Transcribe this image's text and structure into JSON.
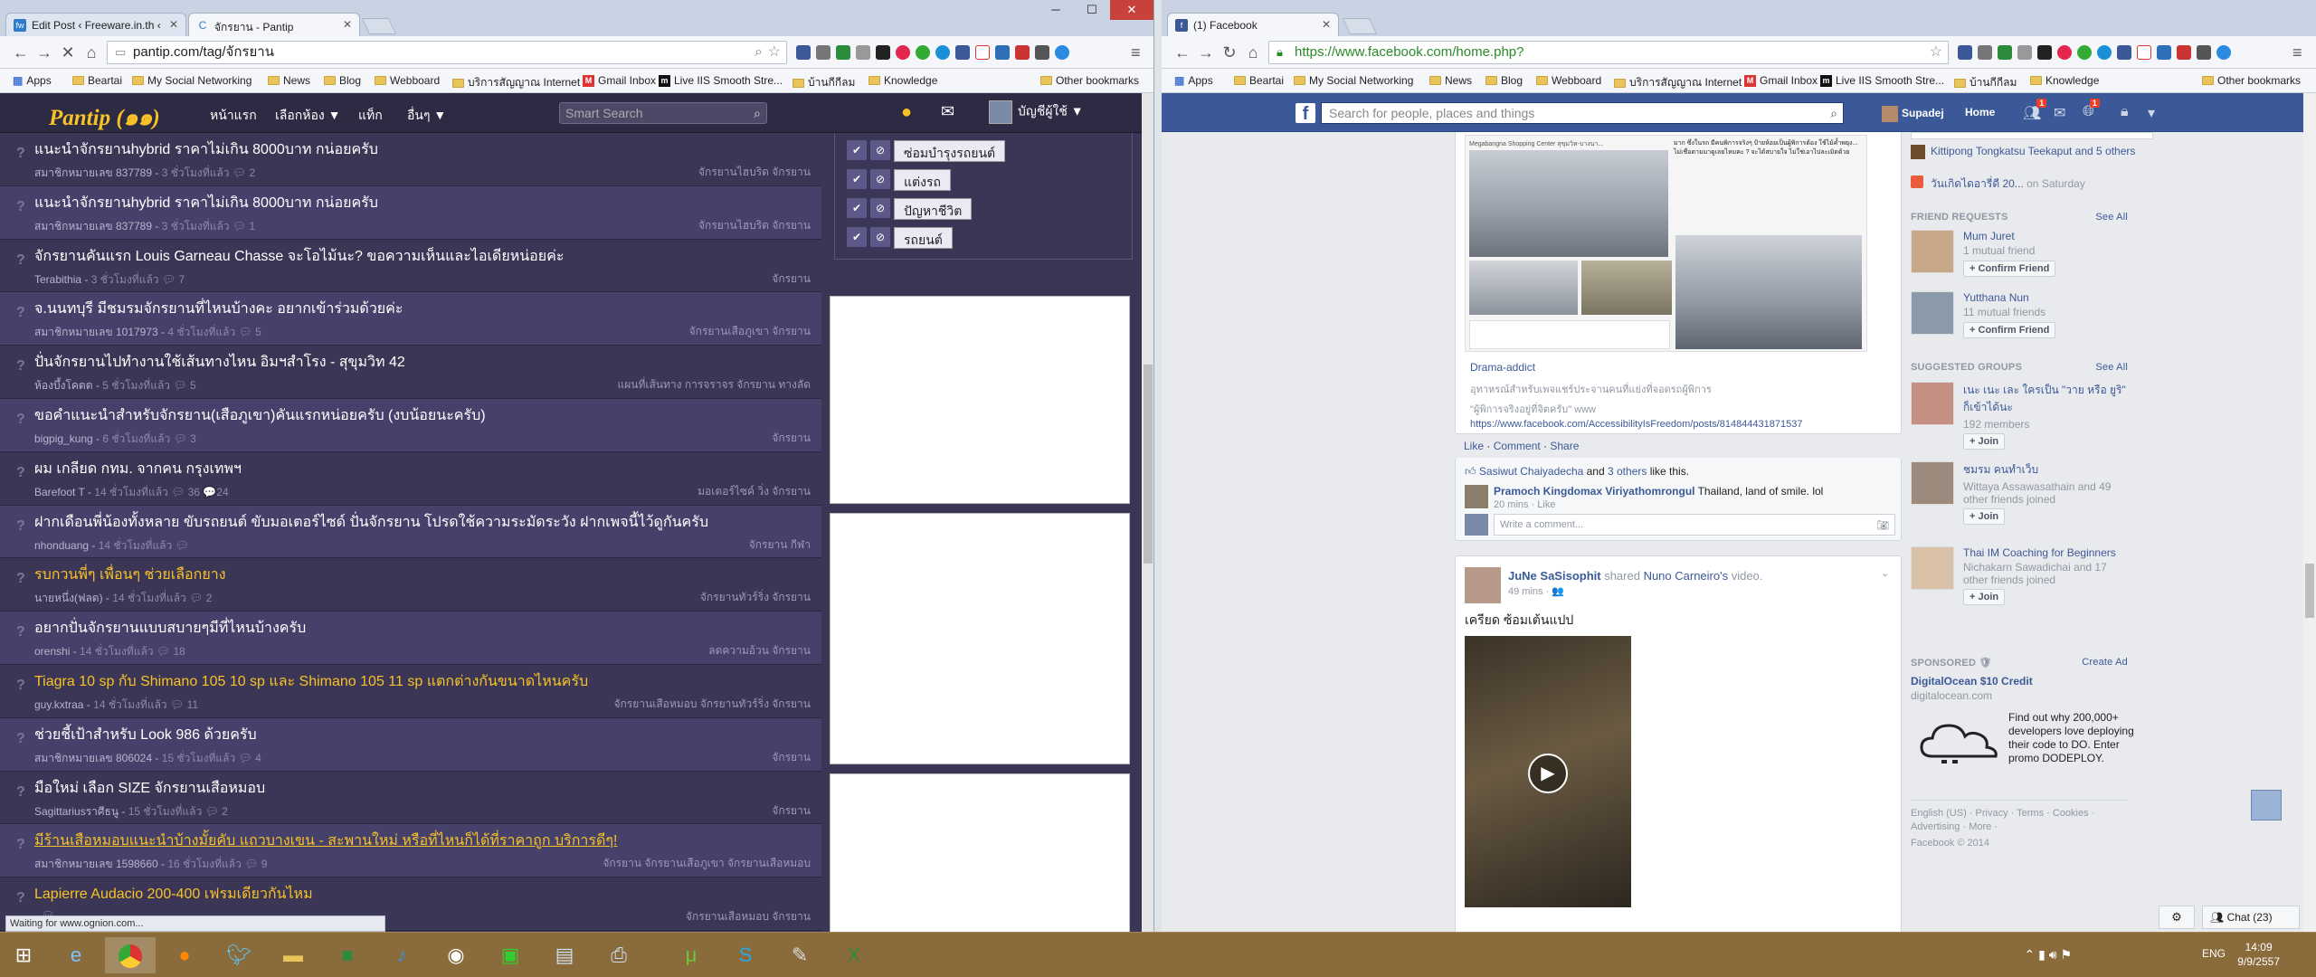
{
  "left_window": {
    "tabs": [
      {
        "favicon": "fw",
        "label": "Edit Post ‹ Freeware.in.th ‹",
        "active": false
      },
      {
        "favicon": "C",
        "label": "จักรยาน - Pantip",
        "active": true
      }
    ],
    "url": "pantip.com/tag/จักรยาน",
    "status": "Waiting for www.ognion.com...",
    "pantip": {
      "logo": "Pantip",
      "logo_sub": "(๑๑)",
      "nav": [
        "หน้าแรก",
        "เลือกห้อง ▼",
        "แท็ก",
        "อื่นๆ ▼"
      ],
      "search_placeholder": "Smart Search",
      "user": "บัญชีผู้ใช้ ▼",
      "tag_labels": [
        "ซ่อมบำรุงรถยนต์",
        "แต่งรถ",
        "ปัญหาชีวิต",
        "รถยนต์"
      ],
      "topics": [
        {
          "title": "แนะนำจักรยานhybrid ราคาไม่เกิน 8000บาท กน่อยครับ",
          "author": "สมาชิกหมายเลข 837789",
          "time": "3 ชั่วโมงที่แล้ว",
          "comments": "2",
          "tags": "จักรยานไฮบริด   จักรยาน",
          "style": ""
        },
        {
          "title": "แนะนำจักรยานhybrid ราคาไม่เกิน 8000บาท กน่อยครับ",
          "author": "สมาชิกหมายเลข 837789",
          "time": "3 ชั่วโมงที่แล้ว",
          "comments": "1",
          "tags": "จักรยานไฮบริด   จักรยาน",
          "style": ""
        },
        {
          "title": "จักรยานคันแรก Louis Garneau Chasse จะโอไม้นะ? ขอความเห็นและไอเดียหน่อยค่ะ",
          "author": "Terabithia",
          "time": "3 ชั่วโมงที่แล้ว",
          "comments": "7",
          "tags": "จักรยาน",
          "style": ""
        },
        {
          "title": "จ.นนทบุรี มีชมรมจักรยานที่ไหนบ้างคะ อยากเข้าร่วมด้วยค่ะ",
          "author": "สมาชิกหมายเลข 1017973",
          "time": "4 ชั่วโมงที่แล้ว",
          "comments": "5",
          "tags": "จักรยานเสือภูเขา   จักรยาน",
          "style": ""
        },
        {
          "title": "ปั่นจักรยานไปทำงานใช้เส้นทางไหน อิมฯสำโรง - สุขุมวิท 42",
          "author": "ห้องบึ้งโคตต",
          "time": "5 ชั่วโมงที่แล้ว",
          "comments": "5",
          "tags": "แผนที่เส้นทาง   การจราจร   จักรยาน   ทางลัด",
          "style": ""
        },
        {
          "title": "ขอคำแนะนำสำหรับจักรยาน(เสือภูเขา)คันแรกหน่อยครับ (งบน้อยนะครับ)",
          "author": "bigpig_kung",
          "time": "6 ชั่วโมงที่แล้ว",
          "comments": "3",
          "tags": "จักรยาน",
          "style": ""
        },
        {
          "title": "ผม เกลียด กทม. จากคน กรุงเทพฯ",
          "author": "Barefoot T",
          "time": "14 ชั่วโมงที่แล้ว",
          "comments": "36  💬24",
          "tags": "มอเตอร์ไซค์   วิ่ง   จักรยาน",
          "style": ""
        },
        {
          "title": "ฝากเดือนพี่น้องทั้งหลาย ขับรถยนต์ ขับมอเตอร์ไซด์ ปั่นจักรยาน โปรดใช้ความระมัดระวัง ฝากเพจนี้ไว้ดูกันครับ",
          "author": "nhonduang",
          "time": "14 ชั่วโมงที่แล้ว",
          "comments": "",
          "tags": "จักรยาน   กีฬา",
          "style": ""
        },
        {
          "title": "รบกวนพี่ๆ เพื่อนๆ ช่วยเลือกยาง",
          "author": "นายหนึ่ง(ฟลด)",
          "time": "14 ชั่วโมงที่แล้ว",
          "comments": "2",
          "tags": "จักรยานทัวร์ริ่ง   จักรยาน",
          "style": "y"
        },
        {
          "title": "อยากปั่นจักรยานแบบสบายๆมีที่ไหนบ้างครับ",
          "author": "orenshi",
          "time": "14 ชั่วโมงที่แล้ว",
          "comments": "18",
          "tags": "ลดความอ้วน   จักรยาน",
          "style": ""
        },
        {
          "title": "Tiagra 10 sp กับ Shimano 105 10 sp และ Shimano 105 11 sp แตกต่างกันขนาดไหนครับ",
          "author": "guy.kxtraa",
          "time": "14 ชั่วโมงที่แล้ว",
          "comments": "11",
          "tags": "จักรยานเสือหมอบ   จักรยานทัวร์ริ่ง   จักรยาน",
          "style": "y"
        },
        {
          "title": "ช่วยชี้เป้าสำหรับ Look 986 ด้วยครับ",
          "author": "สมาชิกหมายเลข 806024",
          "time": "15 ชั่วโมงที่แล้ว",
          "comments": "4",
          "tags": "จักรยาน",
          "style": ""
        },
        {
          "title": "มือใหม่ เลือก SIZE จักรยานเสือหมอบ",
          "author": "Sagittariusราศีธนู",
          "time": "15 ชั่วโมงที่แล้ว",
          "comments": "2",
          "tags": "จักรยาน",
          "style": ""
        },
        {
          "title": "มีร้านเสือหมอบแนะนำบ้างมั้ยคับ แถวบางเขน - สะพานใหม่ หรือที่ไหนก็ได้ที่ราคาถูก บริการดีๆ!",
          "author": "สมาชิกหมายเลข 1598660",
          "time": "16 ชั่วโมงที่แล้ว",
          "comments": "9",
          "tags": "จักรยาน   จักรยานเสือภูเขา   จักรยานเสือหมอบ",
          "style": "u"
        },
        {
          "title": "Lapierre Audacio 200-400 เฟรมเดียวกันไหม",
          "author": "",
          "time": "",
          "comments": "",
          "tags": "จักรยานเสือหมอบ   จักรยาน",
          "style": "y"
        }
      ]
    }
  },
  "right_window": {
    "tabs": [
      {
        "favicon": "f",
        "label": "(1) Facebook",
        "active": true
      }
    ],
    "url": "https://www.facebook.com/home.php?",
    "facebook": {
      "search_placeholder": "Search for people, places and things",
      "user": "Supadej",
      "home": "Home",
      "badges": {
        "friends": "1",
        "messages": "",
        "notifications": "1"
      },
      "post1": {
        "page_name": "Drama-addict",
        "desc": "อุทาหรณ์สำหรับเพจแชร์ประจานคนที่แย่งที่จอดรถผู้พิการ",
        "quote": "\"ผู้พิการจริงอยู่ที่จิตครับ\" www",
        "link": "https://www.facebook.com/AccessibilityIsFreedom/posts/814844431871537",
        "actions": [
          "Like",
          "Comment",
          "Share"
        ],
        "likes_a": "Sasiwut Chaiyadecha",
        "likes_b": " and ",
        "likes_c": "3 others",
        "likes_d": " like this.",
        "comment_author": "Pramoch Kingdomax Viriyathomrongul",
        "comment_text": " Thailand, land of smile. lol",
        "comment_meta": "20 mins · Like",
        "write_comment": "Write a comment...",
        "img_caption_top": "Megabangna Shopping Center สุขุมวิท-บางนา...",
        "img_text": "มาก ซึ่งในรถ มีคนพิการจริงๆ ป้ายห้อยเป็นผู้พิการต้อง ใช้ไม้ค้ำพยุง... ไม่เชื่อตามมาดูเลยไหมคะ ? จะได้สบายใจ ไม่ใช่เอาไปละเมิดด้วย"
      },
      "post2": {
        "author": "JuNe SaSisophit",
        "shared": " shared ",
        "shared_from": "Nuno Carneiro's",
        "shared_obj": " video.",
        "time": "49 mins · 👥",
        "text": "เครียด ซ้อมเต้นแปป"
      },
      "right_column": {
        "top_name": "Kittipong Tongkatsu Teekaput",
        "top_and": " and 5 others",
        "event": "วันเกิดไดอารี่ดี 20...",
        "event_when": " on Saturday",
        "friend_requests_title": "FRIEND REQUESTS",
        "see_all": "See All",
        "requests": [
          {
            "name": "Mum Juret",
            "mutual": "1 mutual friend",
            "btn": "Confirm Friend"
          },
          {
            "name": "Yutthana Nun",
            "mutual": "11 mutual friends",
            "btn": "Confirm Friend"
          }
        ],
        "groups_title": "SUGGESTED GROUPS",
        "groups": [
          {
            "name": "เนะ เนะ เละ ใครเป็น \"วาย หรือ ยูริ\" ก็เข้าได้นะ",
            "info": "192 members",
            "btn": "Join"
          },
          {
            "name": "ชมรม คนทำเว็บ",
            "info": "Wittaya Assawasathain and 49 other friends joined",
            "btn": "Join"
          },
          {
            "name": "Thai IM Coaching for Beginners",
            "info": "Nichakarn Sawadichai and 17 other friends joined",
            "btn": "Join"
          }
        ],
        "sponsored": "SPONSORED 🛡",
        "create_ad": "Create Ad",
        "ad_title": "DigitalOcean $10 Credit",
        "ad_domain": "digitalocean.com",
        "ad_text": "Find out why 200,000+ developers love deploying their code to DO. Enter promo DODEPLOY.",
        "footer": "English (US) · Privacy · Terms · Cookies · Advertising · More ·",
        "copyright": "Facebook © 2014"
      },
      "chat": "Chat (23)"
    }
  },
  "bookmarks": [
    "Apps",
    "Beartai",
    "My Social Networking",
    "News",
    "Blog",
    "Webboard",
    "บริการสัญญาณ Internet",
    "Gmail Inbox",
    "Live IIS Smooth Stre...",
    "บ้านกีกีลม",
    "Knowledge"
  ],
  "other_bookmarks": "Other bookmarks",
  "taskbar": {
    "lang": "ENG",
    "time": "14:09",
    "date": "9/9/2557"
  }
}
